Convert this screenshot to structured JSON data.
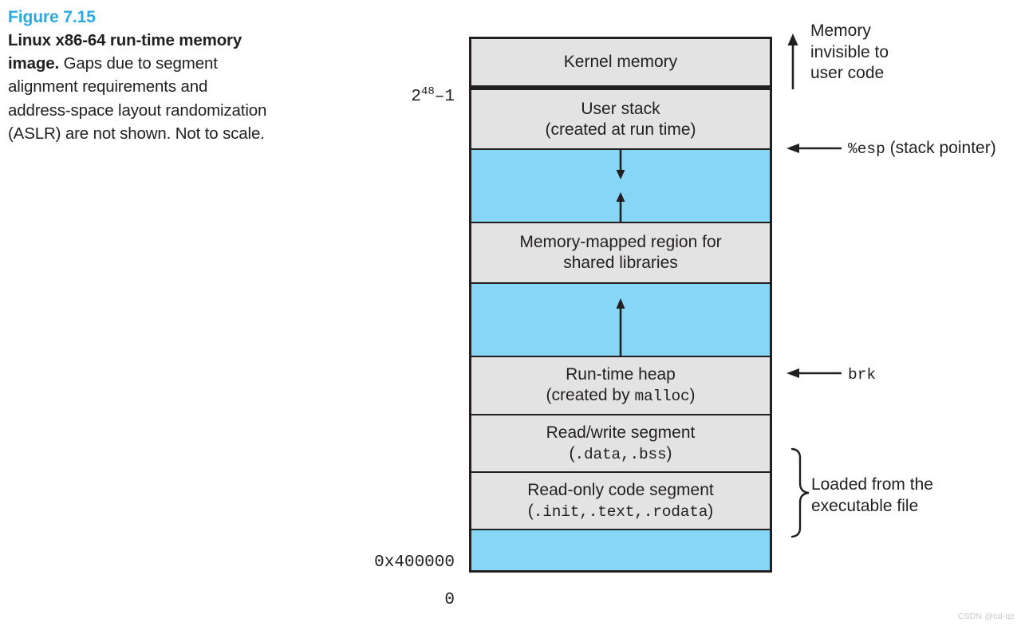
{
  "caption": {
    "figure_number": "Figure 7.15",
    "title": "Linux x86-64 run-time memory image.",
    "body": " Gaps due to segment alignment requirements and address-space layout randomization (ASLR) are not shown. Not to scale."
  },
  "colors": {
    "accent": "#29abe2",
    "segment_fill": "#e3e3e3",
    "gap_fill": "#87d6f5",
    "stroke": "#231f20"
  },
  "diagram": {
    "regions": [
      {
        "id": "kernel-memory",
        "line1": "Kernel memory",
        "line2": "",
        "line2_mono": "",
        "fill": "gray"
      },
      {
        "id": "user-stack",
        "line1": "User stack",
        "line2": "(created at run time)",
        "line2_mono": "",
        "fill": "gray"
      },
      {
        "id": "stack-gap",
        "line1": "",
        "line2": "",
        "line2_mono": "",
        "fill": "blue"
      },
      {
        "id": "memory-mapped",
        "line1": "Memory-mapped region for",
        "line2": "shared libraries",
        "line2_mono": "",
        "fill": "gray"
      },
      {
        "id": "heap-gap",
        "line1": "",
        "line2": "",
        "line2_mono": "",
        "fill": "blue"
      },
      {
        "id": "run-time-heap",
        "line1": "Run-time heap",
        "line2": "(created by ",
        "line2_mono": "malloc",
        "line2_tail": ")",
        "fill": "gray"
      },
      {
        "id": "read-write-segment",
        "line1": "Read/write segment",
        "line2": "(",
        "line2_mono": ".data,.bss",
        "line2_tail": ")",
        "fill": "gray"
      },
      {
        "id": "read-only-segment",
        "line1": "Read-only code segment",
        "line2": "(",
        "line2_mono": ".init,.text,.rodata",
        "line2_tail": ")",
        "fill": "gray"
      },
      {
        "id": "bottom-gap",
        "line1": "",
        "line2": "",
        "line2_mono": "",
        "fill": "blue"
      }
    ],
    "address_labels": [
      {
        "id": "addr-top",
        "base": "2",
        "exponent": "48",
        "suffix": "–1"
      },
      {
        "id": "addr-text",
        "base": "0x400000",
        "exponent": "",
        "suffix": ""
      },
      {
        "id": "addr-zero",
        "base": "0",
        "exponent": "",
        "suffix": ""
      }
    ],
    "annotations": {
      "kernel_note_line1": "Memory",
      "kernel_note_line2": "invisible to",
      "kernel_note_line3": "user code",
      "stack_pointer_mono": "%esp",
      "stack_pointer_text": "(stack pointer)",
      "brk_mono": "brk",
      "loaded_line1": "Loaded from the",
      "loaded_line2": "executable file"
    }
  },
  "watermark": "CSDN @cd-qz"
}
